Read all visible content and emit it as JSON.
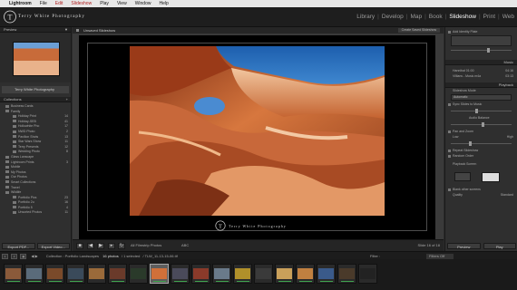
{
  "menubar": {
    "apple": "",
    "app": "Lightroom",
    "items": [
      "File",
      "Edit",
      "Slideshow",
      "Play",
      "View",
      "Window",
      "Help"
    ]
  },
  "identity": {
    "brand": "Terry White Photography"
  },
  "modules": {
    "items": [
      "Library",
      "Develop",
      "Map",
      "Book",
      "Slideshow",
      "Print",
      "Web"
    ],
    "active": "Slideshow"
  },
  "left_panel": {
    "preview_header": "Preview",
    "template_name": "Terry White Photography",
    "collections_header": "Collections",
    "collections": [
      {
        "name": "Business Cards",
        "count": ""
      },
      {
        "name": "Family",
        "count": ""
      },
      {
        "name": "Holiday Print",
        "count": "14"
      },
      {
        "name": "Holiday-SEB",
        "count": "41"
      },
      {
        "name": "Hollowhite Pho",
        "count": "17"
      },
      {
        "name": "NWD Photo",
        "count": "2"
      },
      {
        "name": "Pavilion Shots",
        "count": "13"
      },
      {
        "name": "Star Wars Show",
        "count": "11"
      },
      {
        "name": "Terry Presents",
        "count": "12"
      },
      {
        "name": "Wedding Photo",
        "count": "8"
      },
      {
        "name": "Glass Lanscape",
        "count": ""
      },
      {
        "name": "Lightroom Prints",
        "count": "3"
      },
      {
        "name": "Mobile",
        "count": ""
      },
      {
        "name": "My Photos",
        "count": ""
      },
      {
        "name": "Our Photos",
        "count": ""
      },
      {
        "name": "Smart Collections",
        "count": ""
      },
      {
        "name": "Travel",
        "count": ""
      },
      {
        "name": "Wildlife",
        "count": ""
      },
      {
        "name": "Portfolio Pics",
        "count": "23"
      },
      {
        "name": "Portfolio 2u",
        "count": "16"
      },
      {
        "name": "Portfolio 5",
        "count": "4"
      },
      {
        "name": "Unsorted Photos",
        "count": "11"
      }
    ],
    "export_pdf": "Export PDF...",
    "export_video": "Export Video..."
  },
  "center": {
    "title": "Unsaved Slideshow",
    "create_button": "Create Saved Slideshow",
    "toolbar": {
      "source": "All Filmstrip Photos",
      "style": "ABC",
      "counter": "Slide 16 of 18"
    }
  },
  "right_panel": {
    "identity_label": "Add Identity Plate",
    "music_header": "Music",
    "music_track_1": "Hannibal 01:00",
    "music_track_1_time": "04:16",
    "music_track_2": "Villians - Music.m4a",
    "music_track_2_time": "03:13",
    "playback_header": "Playback",
    "slideshow_mode": "Slideshow Mode",
    "mode_value": "Automatic",
    "sync_label": "Sync Slides to Music",
    "audio_balance": "Audio Balance",
    "pan_zoom": "Pan and Zoom",
    "low": "Low",
    "high": "High",
    "repeat": "Repeat Slideshow",
    "random": "Random Order",
    "playback_screen": "Playback Screen",
    "blank_other": "Blank other screens",
    "quality_label": "Quality",
    "quality_value": "Standard",
    "preview_button": "Preview",
    "play_button": "Play"
  },
  "filmstrip_bar": {
    "collection": "Collection : Portfolio Landscapes",
    "count": "16 photos",
    "selection": "/ 1 selected",
    "filename": "/ TLW_11-13-15-06.tif",
    "filter_label": "Filter :",
    "filter_value": "Filters Off"
  },
  "filmstrip": {
    "selected_index": 7,
    "thumbs": [
      {
        "tone": "#8a5a3a",
        "stars": true
      },
      {
        "tone": "#5a6b7a",
        "stars": true
      },
      {
        "tone": "#7a4a2a",
        "stars": true
      },
      {
        "tone": "#3a4a5a",
        "stars": true
      },
      {
        "tone": "#9a6a3a",
        "stars": false
      },
      {
        "tone": "#6a3a2a",
        "stars": true
      },
      {
        "tone": "#2a3a2a",
        "stars": false
      },
      {
        "tone": "#d0703a",
        "stars": true
      },
      {
        "tone": "#4a4a5a",
        "stars": true
      },
      {
        "tone": "#8a3a2a",
        "stars": true
      },
      {
        "tone": "#6a7a8a",
        "stars": true
      },
      {
        "tone": "#b0902a",
        "stars": true
      },
      {
        "tone": "#3a3a3a",
        "stars": false
      },
      {
        "tone": "#caa05a",
        "stars": true
      },
      {
        "tone": "#c08040",
        "stars": true
      },
      {
        "tone": "#3a5a8a",
        "stars": true
      },
      {
        "tone": "#4a3a2a",
        "stars": true
      },
      {
        "tone": "#222222",
        "stars": false
      }
    ]
  }
}
